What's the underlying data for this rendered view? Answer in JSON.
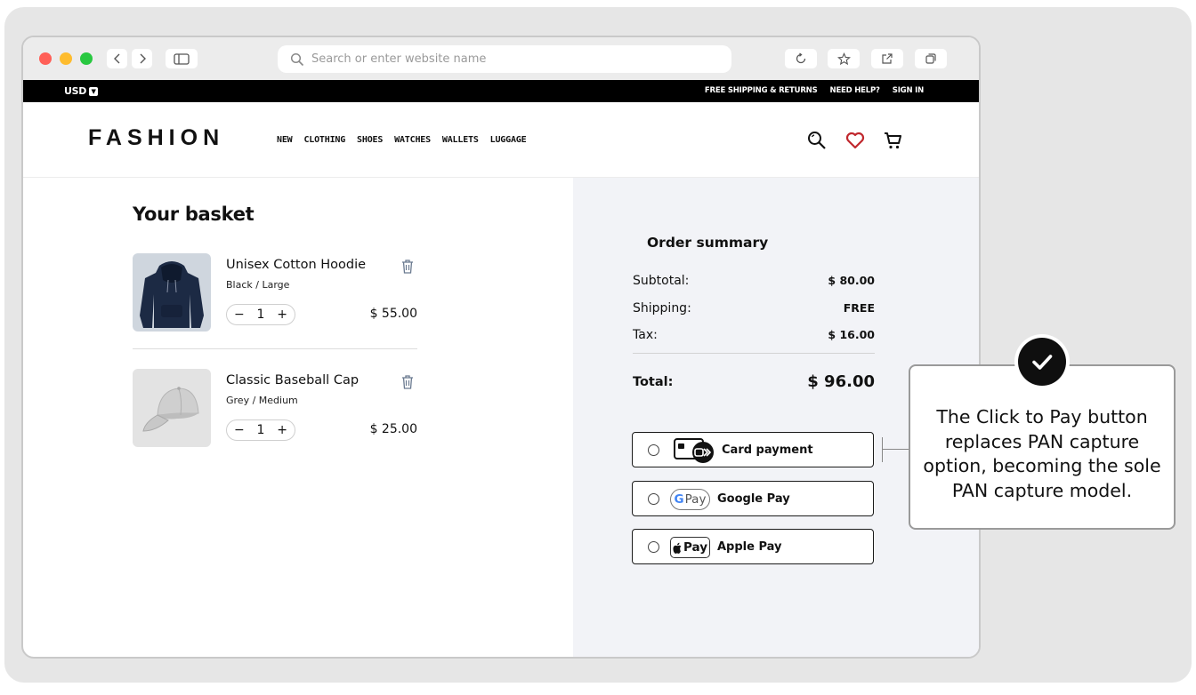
{
  "browser": {
    "url_placeholder": "Search or enter website name"
  },
  "promo_bar": {
    "currency": "USD",
    "links": [
      "FREE SHIPPING & RETURNS",
      "NEED HELP?",
      "SIGN IN"
    ]
  },
  "header": {
    "logo": "FASHION",
    "nav": [
      "NEW",
      "CLOTHING",
      "SHOES",
      "WATCHES",
      "WALLETS",
      "LUGGAGE"
    ],
    "icons": [
      "search-icon",
      "heart-icon",
      "cart-icon"
    ]
  },
  "basket": {
    "title": "Your basket",
    "items": [
      {
        "name": "Unisex Cotton Hoodie",
        "variant": "Black / Large",
        "quantity": "1",
        "price": "$ 55.00"
      },
      {
        "name": "Classic Baseball Cap",
        "variant": "Grey / Medium",
        "quantity": "1",
        "price": "$ 25.00"
      }
    ]
  },
  "summary": {
    "title": "Order summary",
    "rows": [
      {
        "label": "Subtotal:",
        "value": "$ 80.00"
      },
      {
        "label": "Shipping:",
        "value": "FREE"
      },
      {
        "label": "Tax:",
        "value": "$ 16.00"
      }
    ],
    "total_label": "Total:",
    "total_value": "$ 96.00"
  },
  "payment_options": [
    {
      "label": "Card payment"
    },
    {
      "label": "Google Pay",
      "badge": "Pay"
    },
    {
      "label": "Apple Pay",
      "badge": "Pay"
    }
  ],
  "callout": {
    "text": "The Click to Pay button replaces PAN capture option, becoming the sole PAN capture model."
  },
  "colors": {
    "heart": "#c0272d",
    "panel": "#f2f3f7",
    "topbar": "#000000"
  }
}
